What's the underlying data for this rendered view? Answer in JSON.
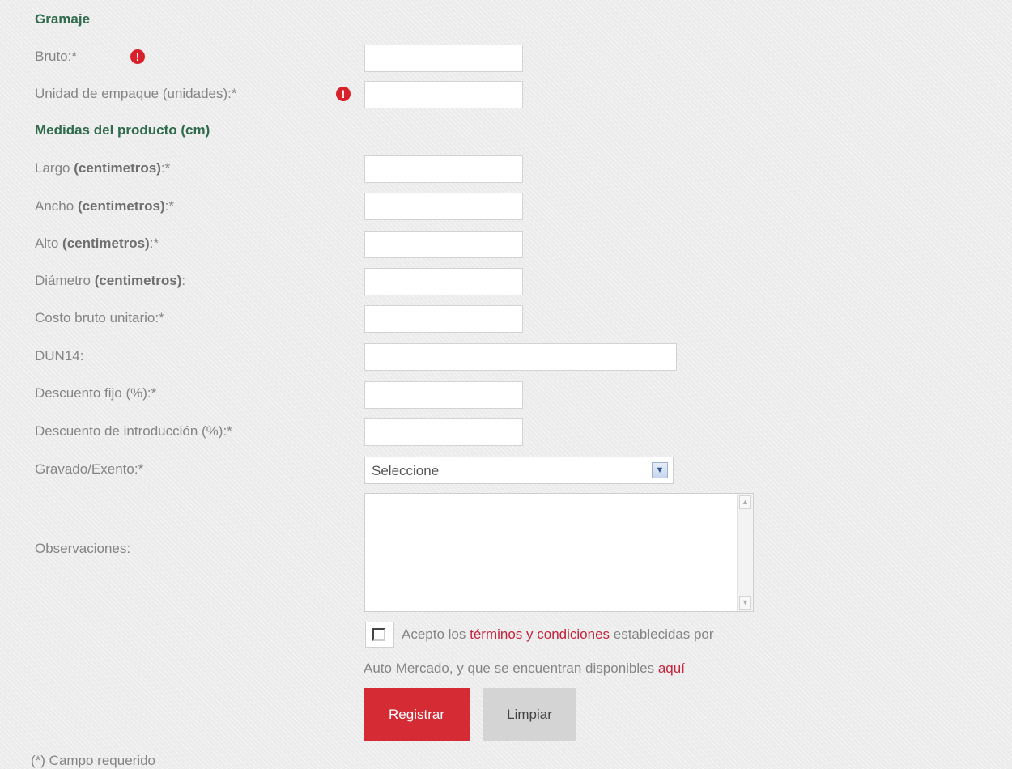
{
  "sections": {
    "gramaje": "Gramaje",
    "medidas": "Medidas del producto (cm)"
  },
  "fields": {
    "bruto": "Bruto:*",
    "unidad_empaque": "Unidad de empaque (unidades):*",
    "largo_a": "Largo ",
    "largo_b": "(centimetros)",
    "largo_c": ":*",
    "ancho_a": "Ancho ",
    "ancho_b": "(centimetros)",
    "ancho_c": ":*",
    "alto_a": "Alto ",
    "alto_b": "(centimetros)",
    "alto_c": ":*",
    "diametro_a": "Diámetro ",
    "diametro_b": "(centimetros)",
    "diametro_c": ":",
    "costo": "Costo bruto unitario:*",
    "dun14": "DUN14:",
    "descuento_fijo": "Descuento fijo (%):*",
    "descuento_intro": "Descuento de introducción (%):*",
    "gravado": "Gravado/Exento:*",
    "observaciones": "Observaciones:"
  },
  "warning_glyph": "!",
  "select": {
    "value": "Seleccione",
    "arrow_glyph": "▼"
  },
  "scroll": {
    "up": "▲",
    "down": "▼"
  },
  "terms": {
    "pre": "Acepto los ",
    "link1": "términos y condiciones",
    "mid": " establecidas por",
    "line2": "Auto Mercado, y que se encuentran disponibles ",
    "link2": "aquí"
  },
  "buttons": {
    "register": "Registrar",
    "clear": "Limpiar"
  },
  "footnote": "(*) Campo requerido",
  "colors": {
    "section_title": "#2f6b4c",
    "warning": "#d8202b",
    "link": "#c4253d",
    "register_button": "#d52b35",
    "clear_button": "#d4d4d4"
  }
}
